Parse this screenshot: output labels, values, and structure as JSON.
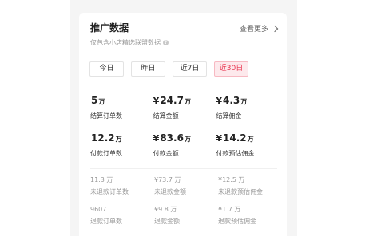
{
  "header": {
    "title": "推广数据",
    "view_more": "查看更多",
    "subtitle": "仅包含小店精选联盟数据"
  },
  "tabs": [
    {
      "label": "今日",
      "active": false
    },
    {
      "label": "昨日",
      "active": false
    },
    {
      "label": "近7日",
      "active": false
    },
    {
      "label": "近30日",
      "active": true
    }
  ],
  "metrics": [
    [
      {
        "currency": "",
        "value": "5",
        "unit": "万",
        "label": "结算订单数"
      },
      {
        "currency": "¥",
        "value": "24.7",
        "unit": "万",
        "label": "结算金额"
      },
      {
        "currency": "¥",
        "value": "4.3",
        "unit": "万",
        "label": "结算佣金"
      }
    ],
    [
      {
        "currency": "",
        "value": "12.2",
        "unit": "万",
        "label": "付款订单数"
      },
      {
        "currency": "¥",
        "value": "83.6",
        "unit": "万",
        "label": "付款金额"
      },
      {
        "currency": "¥",
        "value": "14.2",
        "unit": "万",
        "label": "付款预估佣金"
      }
    ]
  ],
  "secondary_metrics": [
    [
      {
        "value": "11.3 万",
        "label": "未退款订单数"
      },
      {
        "value": "¥73.7 万",
        "label": "未退款金额"
      },
      {
        "value": "¥12.5 万",
        "label": "未退款预估佣金"
      }
    ],
    [
      {
        "value": "9607",
        "label": "退款订单数"
      },
      {
        "value": "¥9.8 万",
        "label": "退款金额"
      },
      {
        "value": "¥1.7 万",
        "label": "退款预估佣金"
      }
    ]
  ],
  "colors": {
    "accent": "#e8344f",
    "accent_bg": "#fde9ec",
    "page_bg": "#f5f5f5"
  }
}
